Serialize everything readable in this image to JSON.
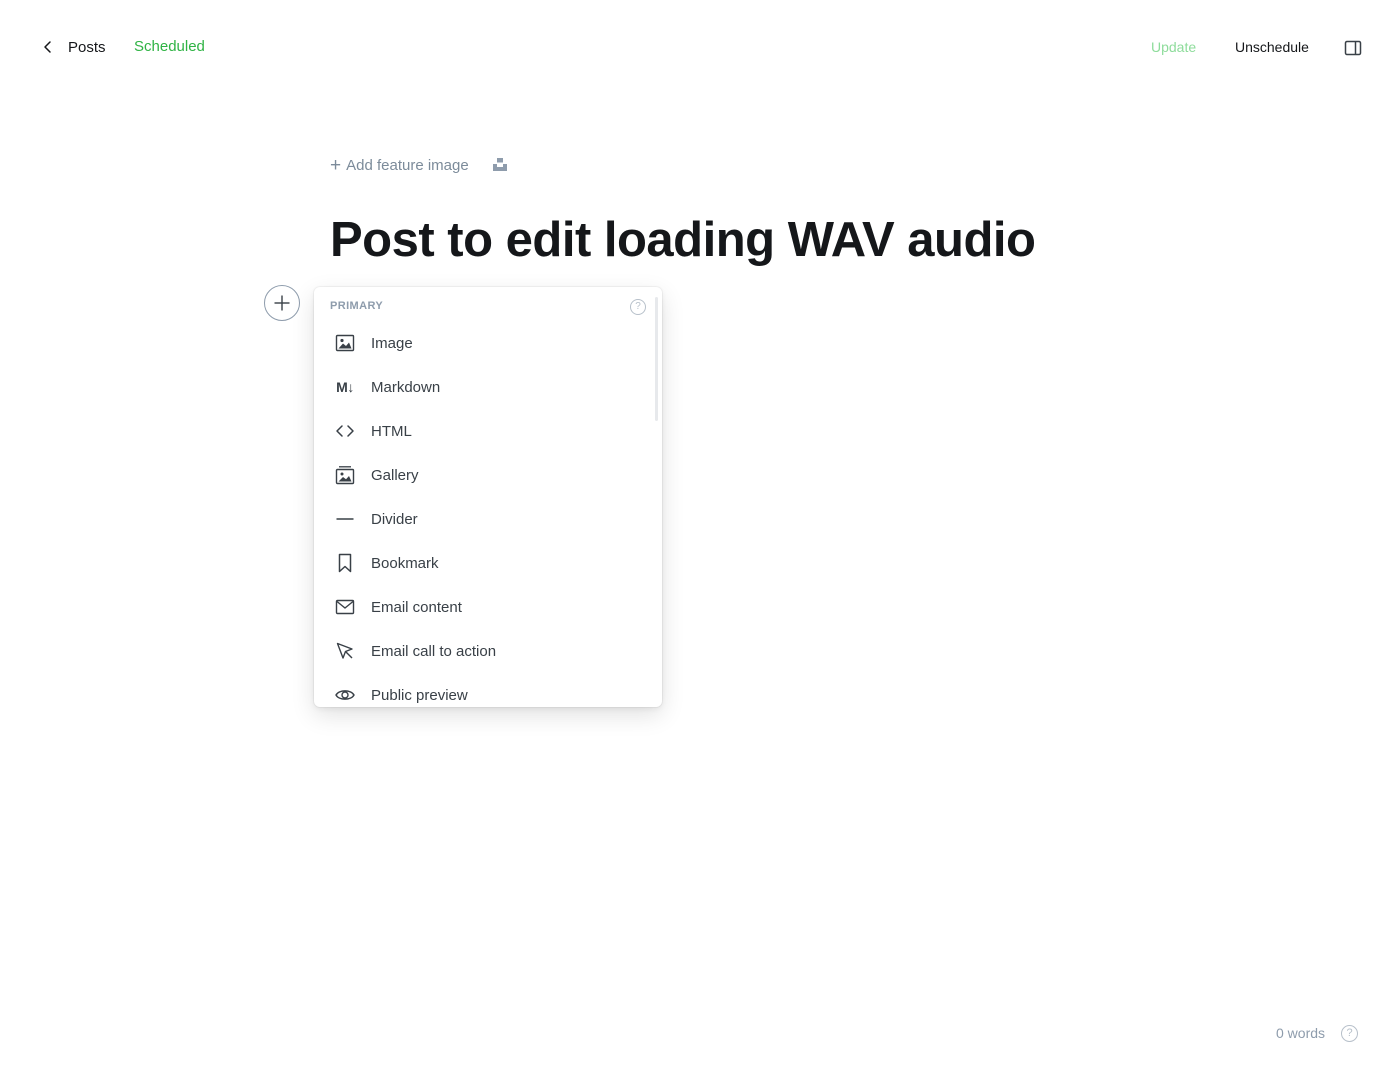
{
  "header": {
    "back_label": "Posts",
    "status": "Scheduled",
    "update_label": "Update",
    "unschedule_label": "Unschedule",
    "colors": {
      "status": "#2fb344",
      "update_disabled": "#8edc9b"
    }
  },
  "editor": {
    "feature_image_label": "Add feature image",
    "title": "Post to edit loading WAV audio"
  },
  "card_menu": {
    "section_heading": "PRIMARY",
    "help_glyph": "?",
    "items": [
      {
        "label": "Image",
        "icon": "image-icon"
      },
      {
        "label": "Markdown",
        "icon": "markdown-icon"
      },
      {
        "label": "HTML",
        "icon": "code-icon"
      },
      {
        "label": "Gallery",
        "icon": "gallery-icon"
      },
      {
        "label": "Divider",
        "icon": "divider-icon"
      },
      {
        "label": "Bookmark",
        "icon": "bookmark-icon"
      },
      {
        "label": "Email content",
        "icon": "email-icon"
      },
      {
        "label": "Email call to action",
        "icon": "cursor-icon"
      },
      {
        "label": "Public preview",
        "icon": "eye-icon"
      }
    ]
  },
  "footer": {
    "word_count": "0 words",
    "help_glyph": "?"
  }
}
